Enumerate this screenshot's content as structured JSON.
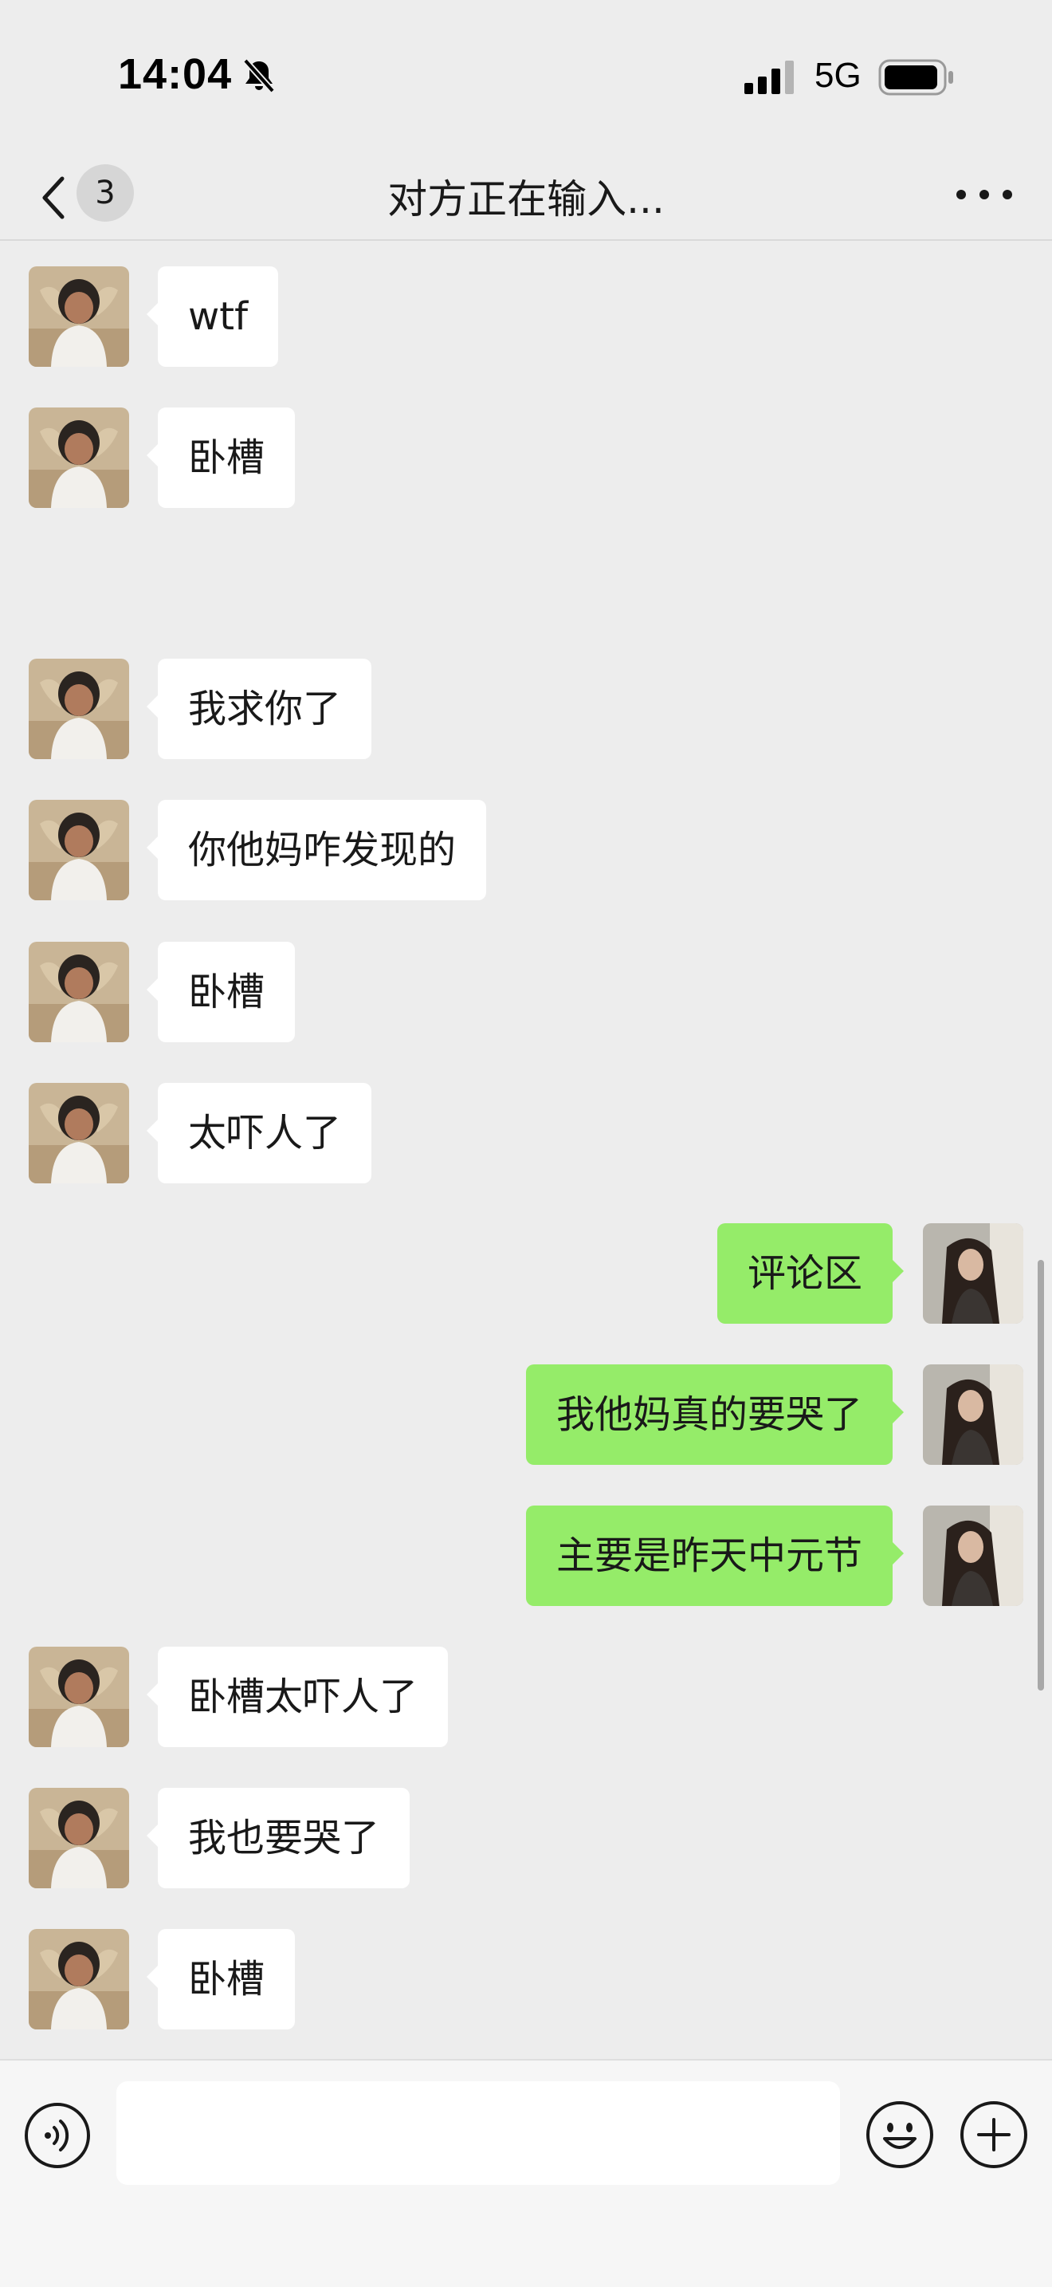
{
  "status_bar": {
    "time": "14:04",
    "network": "5G",
    "icons": [
      "bell-slash-icon",
      "signal-icon",
      "battery-icon"
    ]
  },
  "nav": {
    "unread_count": "3",
    "title": "对方正在输入...",
    "icons": [
      "chevron-left-icon",
      "more-dots-icon"
    ]
  },
  "messages": [
    {
      "side": "in",
      "text": "wtf"
    },
    {
      "side": "in",
      "text": "卧槽"
    },
    {
      "side": "in",
      "text": "我求你了"
    },
    {
      "side": "in",
      "text": "你他妈咋发现的"
    },
    {
      "side": "in",
      "text": "卧槽"
    },
    {
      "side": "in",
      "text": "太吓人了"
    },
    {
      "side": "out",
      "text": "评论区"
    },
    {
      "side": "out",
      "text": "我他妈真的要哭了"
    },
    {
      "side": "out",
      "text": "主要是昨天中元节"
    },
    {
      "side": "in",
      "text": "卧槽太吓人了"
    },
    {
      "side": "in",
      "text": "我也要哭了"
    },
    {
      "side": "in",
      "text": "卧槽"
    }
  ],
  "input_bar": {
    "value": "",
    "icons": [
      "voice-icon",
      "emoji-icon",
      "plus-icon"
    ]
  },
  "colors": {
    "background": "#ededed",
    "incoming_bubble": "#ffffff",
    "outgoing_bubble": "#95ec69",
    "input_bar": "#f6f6f6"
  }
}
